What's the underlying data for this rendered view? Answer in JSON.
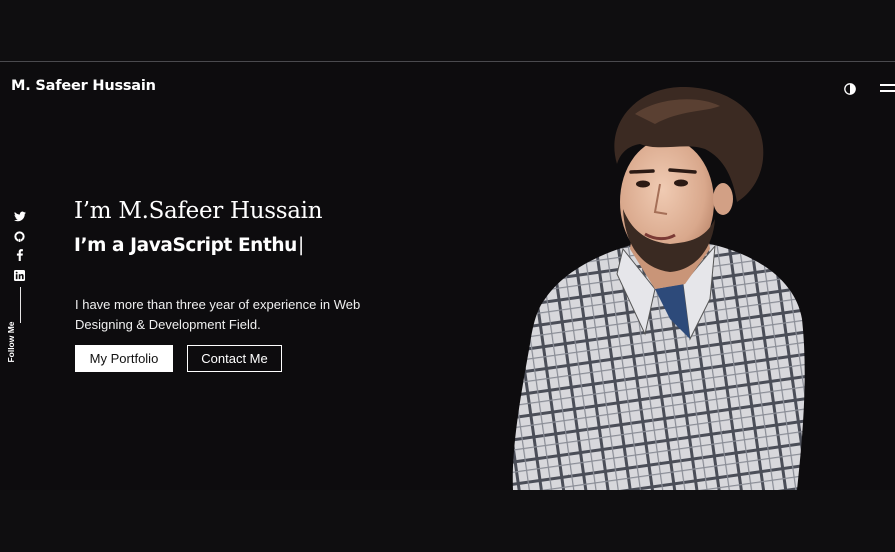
{
  "header": {
    "brand": "M. Safeer Hussain",
    "theme_toggle_icon": "contrast-icon",
    "menu_icon": "hamburger-menu-icon"
  },
  "social": {
    "icons": [
      "twitter-icon",
      "github-icon",
      "facebook-icon",
      "linkedin-icon"
    ],
    "follow_label": "Follow Me"
  },
  "hero": {
    "greeting": "I’m M.Safeer Hussain",
    "role": "I’m a JavaScript Enthu",
    "cursor": "|",
    "description": "I have more than three year of experience in Web Designing & Development Field.",
    "portfolio_button": "My Portfolio",
    "contact_button": "Contact Me"
  },
  "photo": {
    "description_icon": "profile-photo"
  },
  "colors": {
    "background": "#0d0c0e",
    "text": "#ffffff",
    "shirt": "#d9d9dc"
  }
}
